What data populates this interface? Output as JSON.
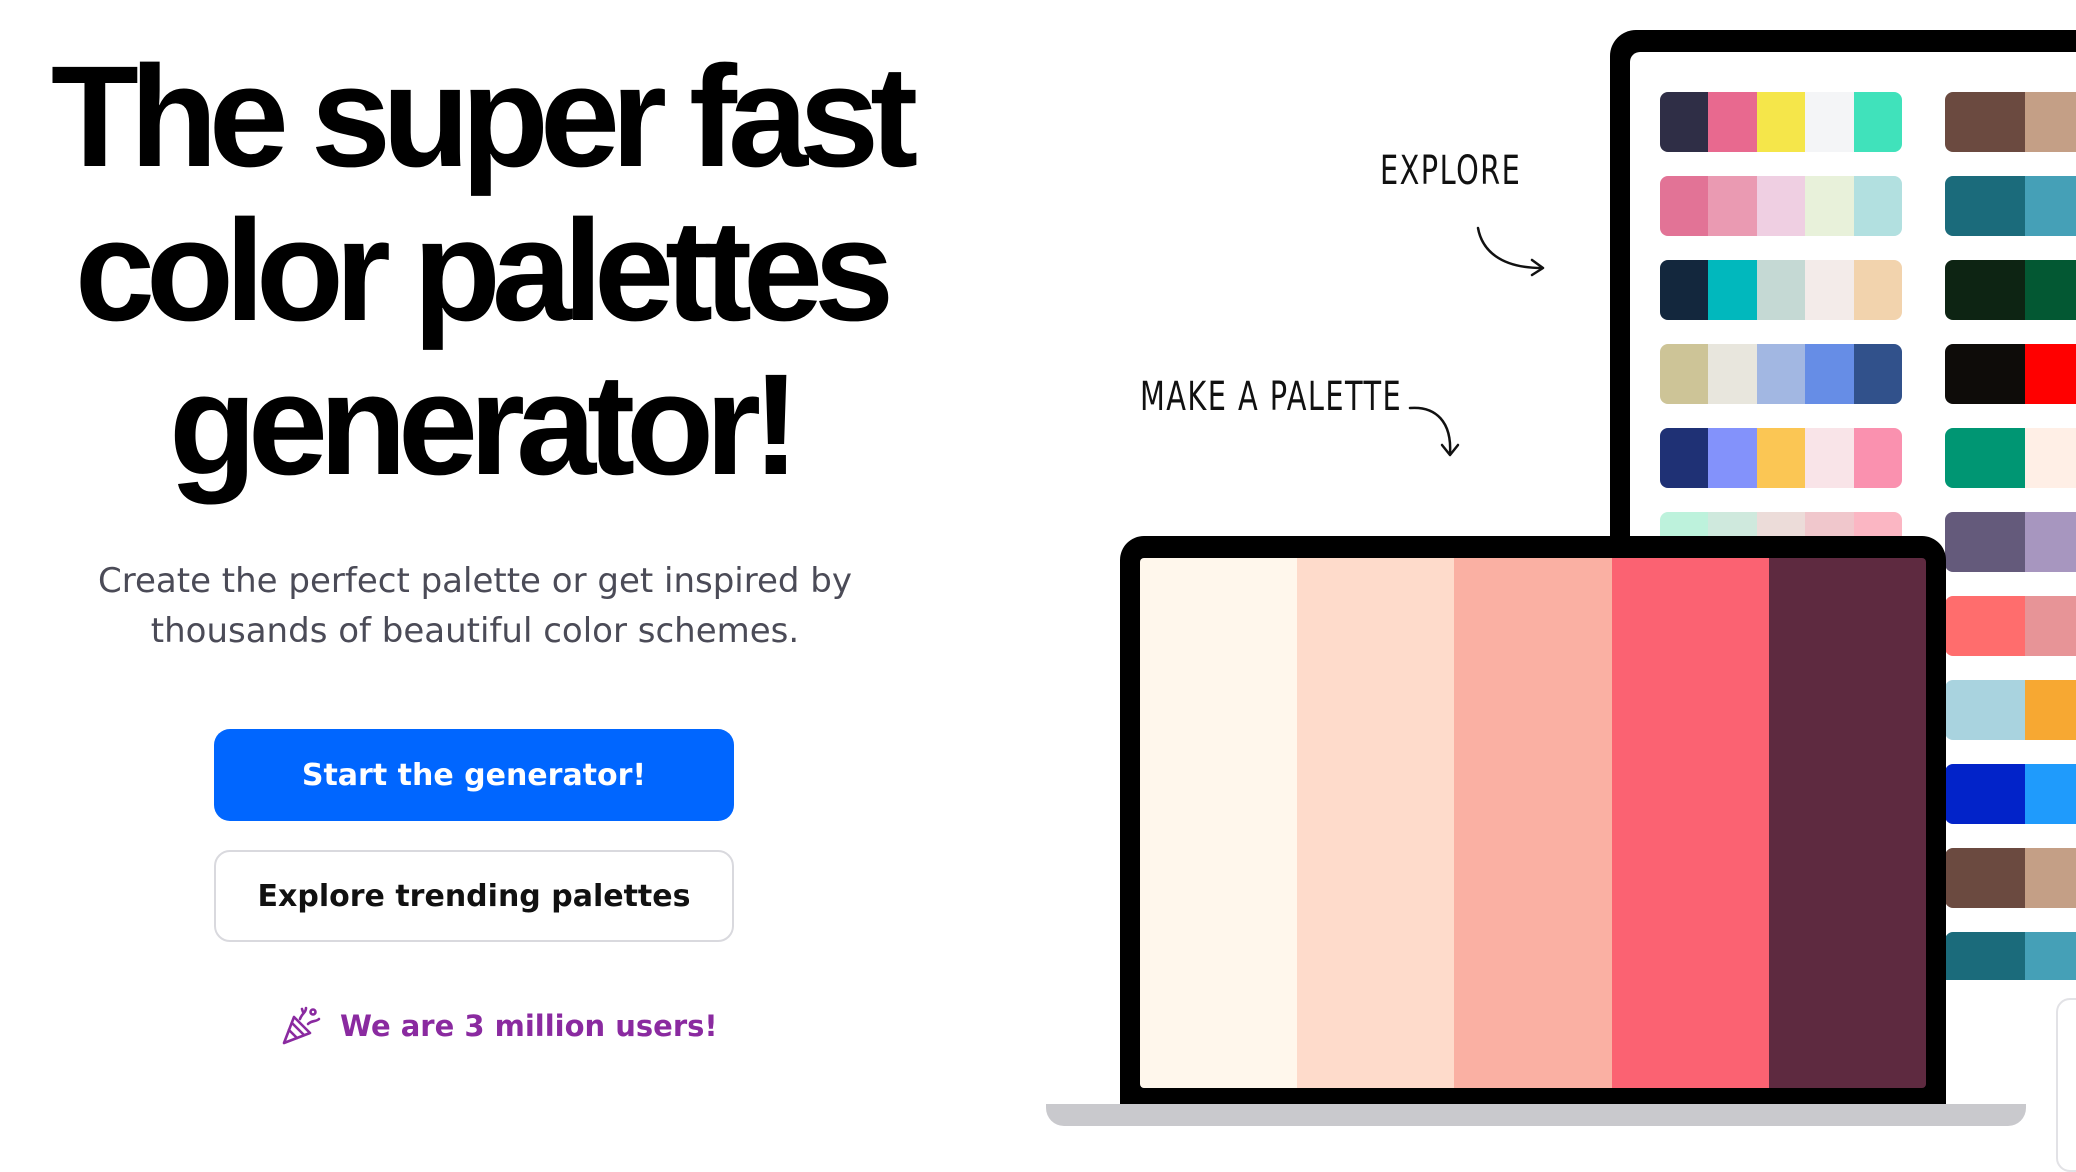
{
  "hero": {
    "headline": [
      "The super fast",
      "color palettes",
      "generator!"
    ],
    "subtitle": [
      "Create the perfect palette or get inspired by",
      "thousands of beautiful color schemes."
    ],
    "primary_button": "Start the generator!",
    "secondary_button": "Explore trending palettes",
    "users_note": "We are 3 million users!",
    "icons": {
      "users_note": "party-popper-icon"
    }
  },
  "illustration": {
    "annotations": {
      "explore": "EXPLORE",
      "make": "MAKE A PALETTE"
    },
    "colors": {
      "primary_button": "#0066ff",
      "users_note": "#8a2aa0",
      "device_frame": "#000000",
      "laptop_base": "#c9c9cd"
    },
    "laptop_palette": [
      "#fff7ec",
      "#fedbcb",
      "#fab0a3",
      "#fb6272",
      "#5e2a40"
    ],
    "monitor_palettes_col1": [
      [
        "#2f2e46",
        "#e8698f",
        "#f5e64a",
        "#f4f5f7",
        "#40e2bb"
      ],
      [
        "#e27396",
        "#ea9ab2",
        "#efcfe2",
        "#e8f1da",
        "#b2e0e0"
      ],
      [
        "#13273d",
        "#01b8bd",
        "#c5d9d4",
        "#f3ebe9",
        "#f2d3ad"
      ],
      [
        "#cdc497",
        "#e8e6dd",
        "#a2b7e2",
        "#668de6",
        "#31518b"
      ],
      [
        "#1f3175",
        "#8392fb",
        "#fbc654",
        "#f9e4e8",
        "#fa91af"
      ],
      [
        "#bdf2dc",
        "#cfe9dd",
        "#ecdcd9",
        "#f0c7cc",
        "#fbb6c3"
      ]
    ],
    "monitor_palettes_col2": [
      [
        "#6b4a40",
        "#c49f86",
        "#fed6b2"
      ],
      [
        "#1b6b7b",
        "#45a0b7",
        "#7ec2cc"
      ],
      [
        "#0d2413",
        "#035833",
        "#da7faf"
      ],
      [
        "#0e0c09",
        "#ff0000",
        "#ff8820"
      ],
      [
        "#009673",
        "#ffefe6",
        "#fdd12e"
      ],
      [
        "#645a7b",
        "#a796bf",
        "#a9bbd7"
      ],
      [
        "#ff6d6d",
        "#e79497",
        "#d5b0b1"
      ],
      [
        "#a9d3df",
        "#f7a832",
        "#fcd35a"
      ],
      [
        "#0223c9",
        "#1f9bfc",
        "#a2d5f7"
      ],
      [
        "#6b4a40",
        "#c49f86",
        "#fed6b2"
      ],
      [
        "#1b6b7b",
        "#45a0b7",
        "#7ec2cc"
      ]
    ]
  }
}
